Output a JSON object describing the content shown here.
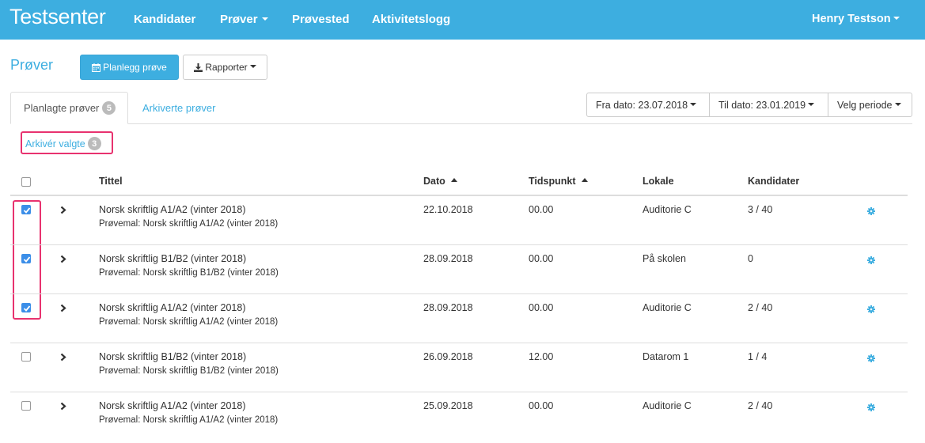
{
  "navbar": {
    "brand": "Testsenter",
    "items": [
      "Kandidater",
      "Prøver",
      "Prøvested",
      "Aktivitetslogg"
    ],
    "user": "Henry Testson"
  },
  "page": {
    "title": "Prøver",
    "plan_button": "Planlegg prøve",
    "reports_button": "Rapporter"
  },
  "tabs": {
    "planned_label": "Planlagte prøver",
    "planned_count": "5",
    "archived_label": "Arkiverte prøver"
  },
  "filters": {
    "from_date": "Fra dato: 23.07.2018",
    "to_date": "Til dato: 23.01.2019",
    "period": "Velg periode"
  },
  "archive": {
    "label": "Arkivér valgte",
    "count": "3"
  },
  "table": {
    "headers": {
      "title": "Tittel",
      "date": "Dato",
      "time": "Tidspunkt",
      "room": "Lokale",
      "candidates": "Kandidater"
    },
    "rows": [
      {
        "checked": true,
        "title": "Norsk skriftlig A1/A2 (vinter 2018)",
        "template": "Prøvemal: Norsk skriftlig A1/A2 (vinter 2018)",
        "date": "22.10.2018",
        "time": "00.00",
        "room": "Auditorie C",
        "candidates": "3 / 40"
      },
      {
        "checked": true,
        "title": "Norsk skriftlig B1/B2 (vinter 2018)",
        "template": "Prøvemal: Norsk skriftlig B1/B2 (vinter 2018)",
        "date": "28.09.2018",
        "time": "00.00",
        "room": "På skolen",
        "candidates": "0"
      },
      {
        "checked": true,
        "title": "Norsk skriftlig A1/A2 (vinter 2018)",
        "template": "Prøvemal: Norsk skriftlig A1/A2 (vinter 2018)",
        "date": "28.09.2018",
        "time": "00.00",
        "room": "Auditorie C",
        "candidates": "2 / 40"
      },
      {
        "checked": false,
        "title": "Norsk skriftlig B1/B2 (vinter 2018)",
        "template": "Prøvemal: Norsk skriftlig B1/B2 (vinter 2018)",
        "date": "26.09.2018",
        "time": "12.00",
        "room": "Datarom 1",
        "candidates": "1 / 4"
      },
      {
        "checked": false,
        "title": "Norsk skriftlig A1/A2 (vinter 2018)",
        "template": "Prøvemal: Norsk skriftlig A1/A2 (vinter 2018)",
        "date": "25.09.2018",
        "time": "00.00",
        "room": "Auditorie C",
        "candidates": "2 / 40"
      }
    ]
  },
  "colors": {
    "brand": "#3daee0",
    "highlight": "#e8326f",
    "checkbox": "#3b8ee8"
  },
  "icons": {
    "plan": "calendar-icon",
    "reports": "download-icon",
    "expand": "chevron-right-icon",
    "settings": "gear-icon"
  }
}
